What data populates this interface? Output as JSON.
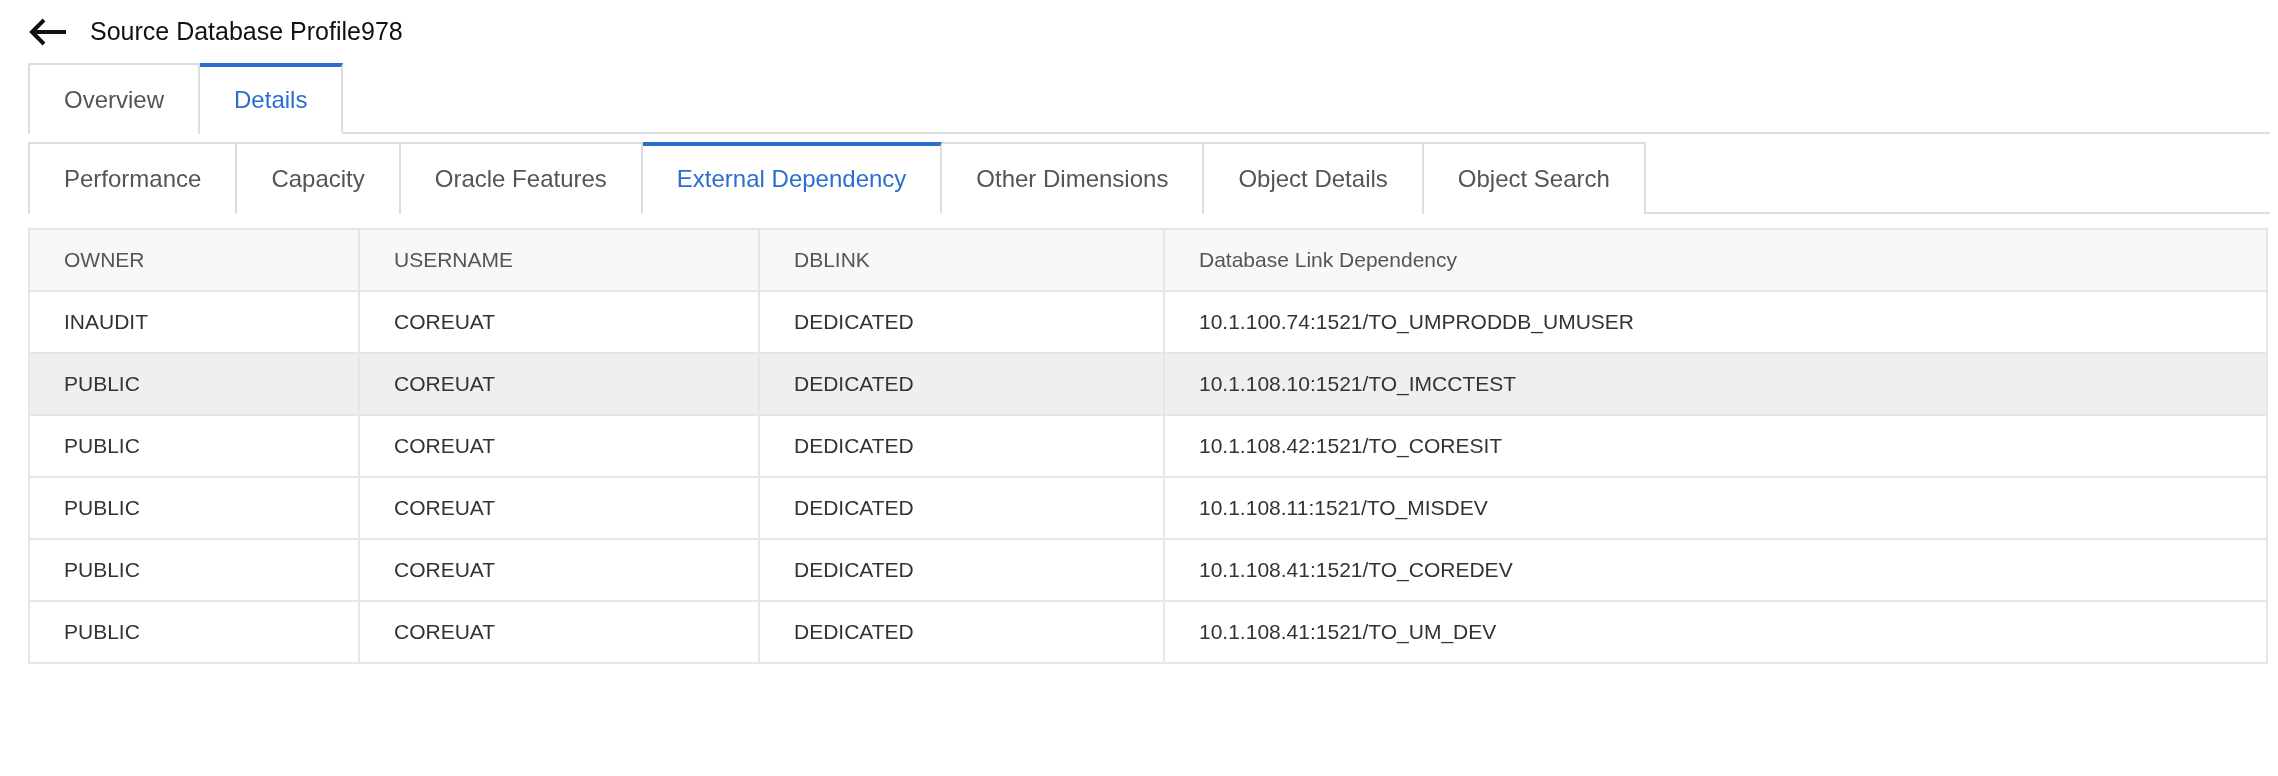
{
  "page": {
    "title": "Source Database Profile978"
  },
  "tabs": [
    {
      "label": "Overview",
      "selected": false
    },
    {
      "label": "Details",
      "selected": true
    }
  ],
  "subtabs": [
    {
      "label": "Performance",
      "selected": false
    },
    {
      "label": "Capacity",
      "selected": false
    },
    {
      "label": "Oracle Features",
      "selected": false
    },
    {
      "label": "External Dependency",
      "selected": true
    },
    {
      "label": "Other Dimensions",
      "selected": false
    },
    {
      "label": "Object Details",
      "selected": false
    },
    {
      "label": "Object Search",
      "selected": false
    }
  ],
  "table": {
    "columns": [
      "OWNER",
      "USERNAME",
      "DBLINK",
      "Database Link Dependency"
    ],
    "rows": [
      {
        "cells": [
          "INAUDIT",
          "COREUAT",
          "DEDICATED",
          "10.1.100.74:1521/TO_UMPRODDB_UMUSER"
        ],
        "selected": false
      },
      {
        "cells": [
          "PUBLIC",
          "COREUAT",
          "DEDICATED",
          "10.1.108.10:1521/TO_IMCCTEST"
        ],
        "selected": true
      },
      {
        "cells": [
          "PUBLIC",
          "COREUAT",
          "DEDICATED",
          "10.1.108.42:1521/TO_CORESIT"
        ],
        "selected": false
      },
      {
        "cells": [
          "PUBLIC",
          "COREUAT",
          "DEDICATED",
          "10.1.108.11:1521/TO_MISDEV"
        ],
        "selected": false
      },
      {
        "cells": [
          "PUBLIC",
          "COREUAT",
          "DEDICATED",
          "10.1.108.41:1521/TO_COREDEV"
        ],
        "selected": false
      },
      {
        "cells": [
          "PUBLIC",
          "COREUAT",
          "DEDICATED",
          "10.1.108.41:1521/TO_UM_DEV"
        ],
        "selected": false
      }
    ]
  }
}
